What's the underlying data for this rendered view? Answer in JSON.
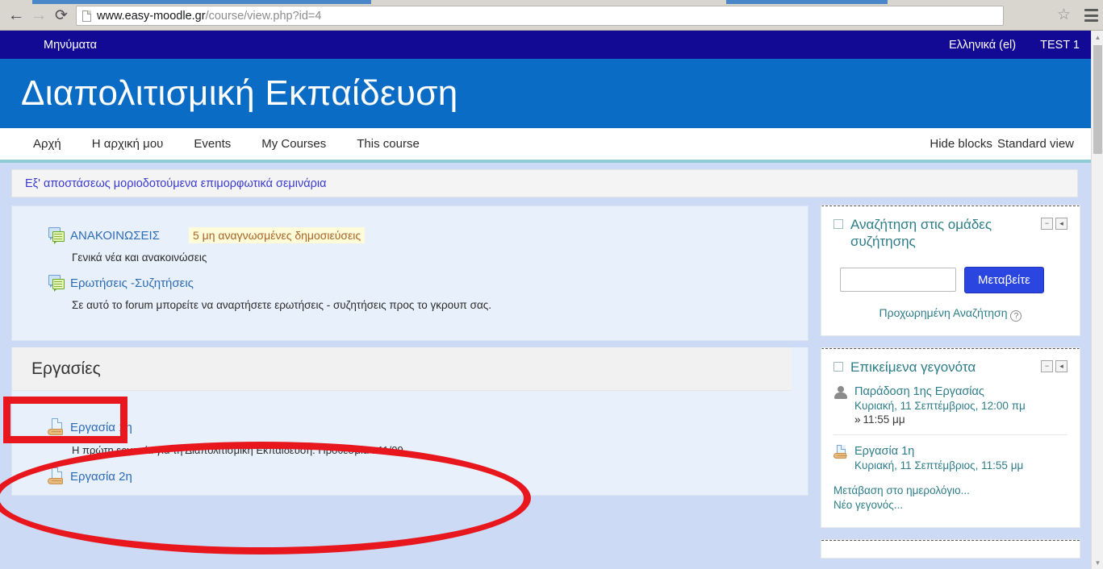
{
  "browser": {
    "url_host": "www.easy-moodle.gr",
    "url_path": "/course/view.php?id=4",
    "back_icon": "←",
    "forward_icon": "→",
    "reload_icon": "⟳",
    "star_icon": "☆"
  },
  "topbar": {
    "messages_label": "Μηνύματα",
    "language_label": "Ελληνικά (el)",
    "user_label": "TEST 1"
  },
  "header": {
    "site_title": "Διαπολιτισμική Εκπαίδευση"
  },
  "menu": {
    "items": [
      {
        "label": "Αρχή"
      },
      {
        "label": "Η αρχική μου"
      },
      {
        "label": "Events"
      },
      {
        "label": "My Courses"
      },
      {
        "label": "This course"
      }
    ],
    "hide_blocks": "Hide blocks",
    "standard_view": "Standard view"
  },
  "breadcrumb": {
    "text": "Εξ' αποστάσεως μοριοδοτούμενα επιμορφωτικά σεμινάρια"
  },
  "general_section": {
    "forums": [
      {
        "name": "ΑΝΑΚΟΙΝΩΣΕΙΣ",
        "badge": "5 μη αναγνωσμένες δημοσιεύσεις",
        "description": "Γενικά νέα και ανακοινώσεις"
      },
      {
        "name": "Ερωτήσεις -Συζητήσεις",
        "badge": "",
        "description": "Σε αυτό το forum μπορείτε να αναρτήσετε ερωτήσεις - συζητήσεις προς το γκρουπ σας."
      }
    ]
  },
  "assignments_section": {
    "title": "Εργασίες",
    "items": [
      {
        "name": "Εργασία 1η",
        "description": "Η πρώτη εργασία για τη Διαπολιτισμική Εκπαίδευση. Προθεσμία : 11/09"
      },
      {
        "name": "Εργασία 2η",
        "description": ""
      }
    ]
  },
  "sidebar": {
    "search_block": {
      "title": "Αναζήτηση στις ομάδες συζήτησης",
      "input_value": "",
      "input_placeholder": "",
      "go_button": "Μεταβείτε",
      "advanced_link": "Προχωρημένη Αναζήτηση",
      "help_icon": "?",
      "collapse_icon": "−",
      "dock_icon": "◂"
    },
    "events_block": {
      "title": "Επικείμενα γεγονότα",
      "collapse_icon": "−",
      "dock_icon": "◂",
      "items": [
        {
          "name": "Παράδοση 1ης Εργασίας",
          "date": "Κυριακή, 11 Σεπτέμβριος, 12:00 πμ",
          "sub": "11:55 μμ",
          "sub_chevron": "»",
          "icon": "user-icon"
        },
        {
          "name": "Εργασία 1η",
          "date": "Κυριακή, 11 Σεπτέμβριος, 11:55 μμ",
          "sub": "",
          "sub_chevron": "",
          "icon": "assignment-icon"
        }
      ],
      "links": [
        {
          "label": "Μετάβαση στο ημερολόγιο..."
        },
        {
          "label": "Νέο γεγονός..."
        }
      ]
    }
  },
  "scrollbar": {
    "up_arrow": "▲",
    "down_arrow": "▼"
  },
  "colors": {
    "navy": "#120a94",
    "header_blue": "#0a6cc4",
    "page_bg": "#ccdaf6",
    "section_bg": "#e7f0fb",
    "teal_accent": "#2e7d88",
    "annotation_red": "#e8161d",
    "go_button_blue": "#2b45e0"
  }
}
